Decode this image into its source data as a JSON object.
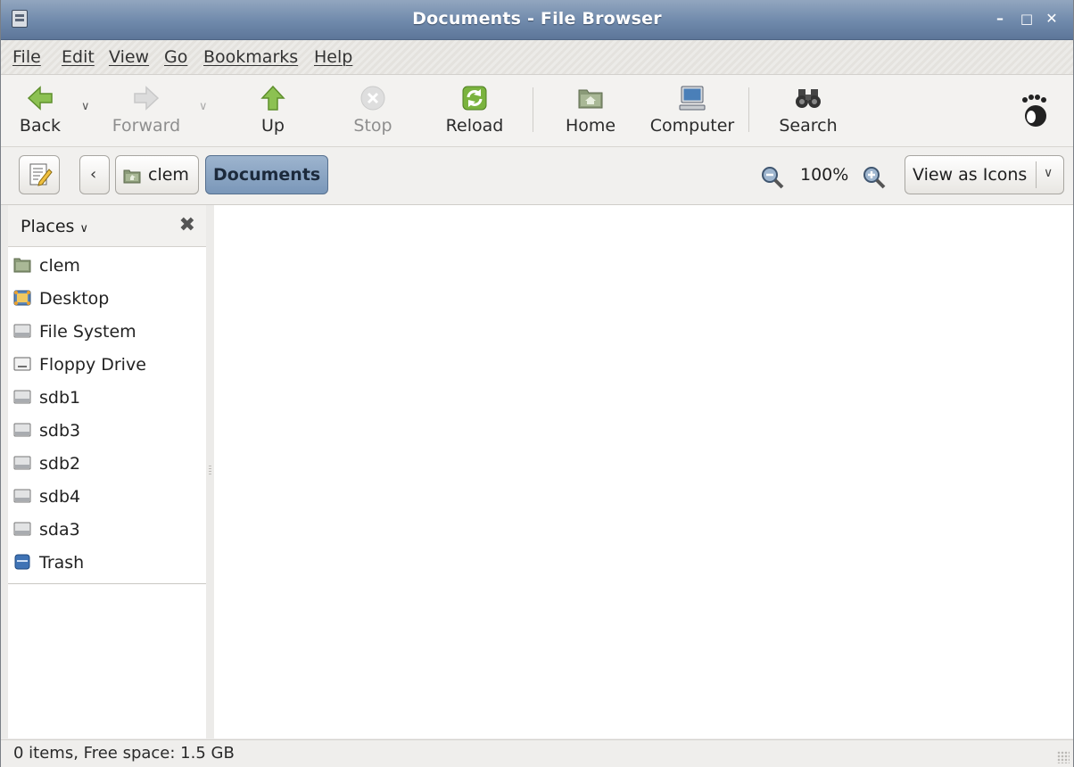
{
  "window": {
    "title": "Documents - File Browser"
  },
  "menu": [
    "File",
    "Edit",
    "View",
    "Go",
    "Bookmarks",
    "Help"
  ],
  "toolbar": {
    "back": "Back",
    "forward": "Forward",
    "up": "Up",
    "stop": "Stop",
    "reload": "Reload",
    "home": "Home",
    "computer": "Computer",
    "search": "Search"
  },
  "location": {
    "crumb_parent": "clem",
    "crumb_current": "Documents",
    "zoom": "100%",
    "view_mode": "View as Icons"
  },
  "sidebar": {
    "title": "Places",
    "items": [
      {
        "label": "clem",
        "icon": "home-folder-icon"
      },
      {
        "label": "Desktop",
        "icon": "desktop-icon"
      },
      {
        "label": "File System",
        "icon": "drive-icon"
      },
      {
        "label": "Floppy Drive",
        "icon": "floppy-icon"
      },
      {
        "label": "sdb1",
        "icon": "drive-icon"
      },
      {
        "label": "sdb3",
        "icon": "drive-icon"
      },
      {
        "label": "sdb2",
        "icon": "drive-icon"
      },
      {
        "label": "sdb4",
        "icon": "drive-icon"
      },
      {
        "label": "sda3",
        "icon": "drive-icon"
      },
      {
        "label": "Trash",
        "icon": "trash-icon"
      }
    ]
  },
  "status": {
    "text": "0 items, Free space: 1.5 GB"
  },
  "colors": {
    "titlebar": "#6f89ab",
    "crumb_active": "#7a97b9",
    "accent_green": "#7ab33e"
  }
}
